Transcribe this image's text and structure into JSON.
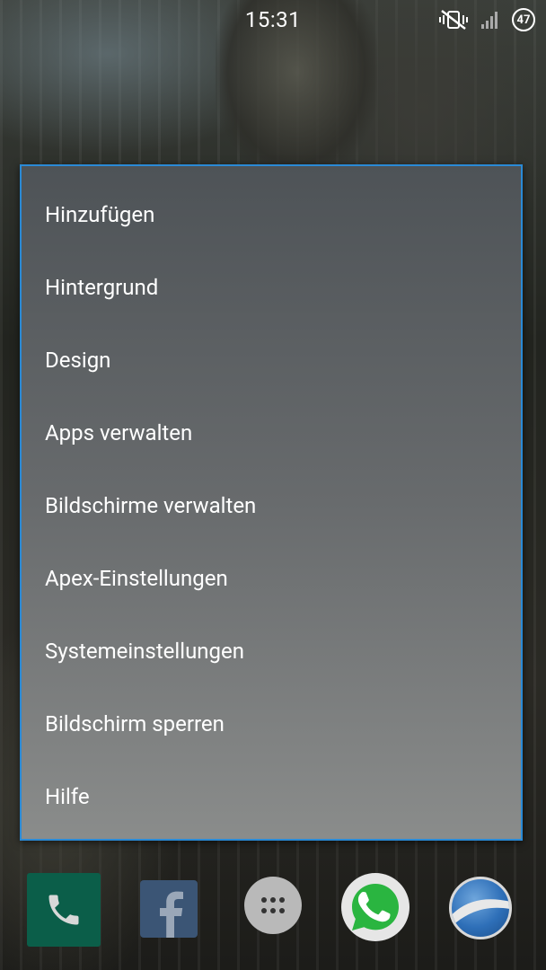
{
  "status_bar": {
    "time": "15:31",
    "battery_level": "47",
    "icons": [
      "vibrate-mute-icon",
      "signal-icon",
      "battery-icon"
    ]
  },
  "menu": {
    "items": [
      {
        "label": "Hinzufügen"
      },
      {
        "label": "Hintergrund"
      },
      {
        "label": "Design"
      },
      {
        "label": "Apps verwalten"
      },
      {
        "label": "Bildschirme verwalten"
      },
      {
        "label": "Apex-Einstellungen"
      },
      {
        "label": "Systemeinstellungen"
      },
      {
        "label": "Bildschirm sperren"
      },
      {
        "label": "Hilfe"
      }
    ]
  },
  "dock": {
    "apps": [
      "phone-icon",
      "facebook-icon",
      "app-drawer-icon",
      "whatsapp-icon",
      "google-earth-icon"
    ]
  },
  "colors": {
    "menu_border": "#2a8ad6",
    "phone_bg": "#0b5e49",
    "facebook_bg": "#3b5575"
  }
}
